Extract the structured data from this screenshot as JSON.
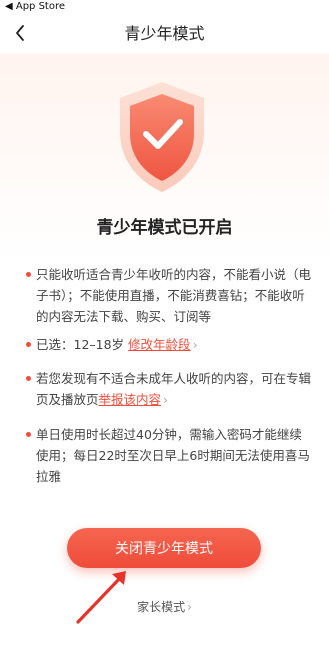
{
  "status_bar": {
    "back_label": "◀ App Store"
  },
  "nav": {
    "title": "青少年模式"
  },
  "hero": {
    "title": "青少年模式已开启"
  },
  "rules": {
    "r1": "只能收听适合青少年收听的内容，不能看小说（电子书）；不能使用直播，不能消费喜钻；不能收听的内容无法下载、购买、订阅等",
    "r2_prefix": "已选：12–18岁 ",
    "r2_link": "修改年龄段",
    "r3_prefix": "若您发现有不适合未成年人收听的内容，可在专辑页及播放页",
    "r3_link": "举报该内容",
    "r4": "单日使用时长超过40分钟，需输入密码才能继续使用；每日22时至次日早上6时期间无法使用喜马拉雅"
  },
  "actions": {
    "close_label": "关闭青少年模式",
    "parent_label": "家长模式"
  },
  "colors": {
    "accent": "#f24d3a",
    "shield": "#f26a55"
  }
}
